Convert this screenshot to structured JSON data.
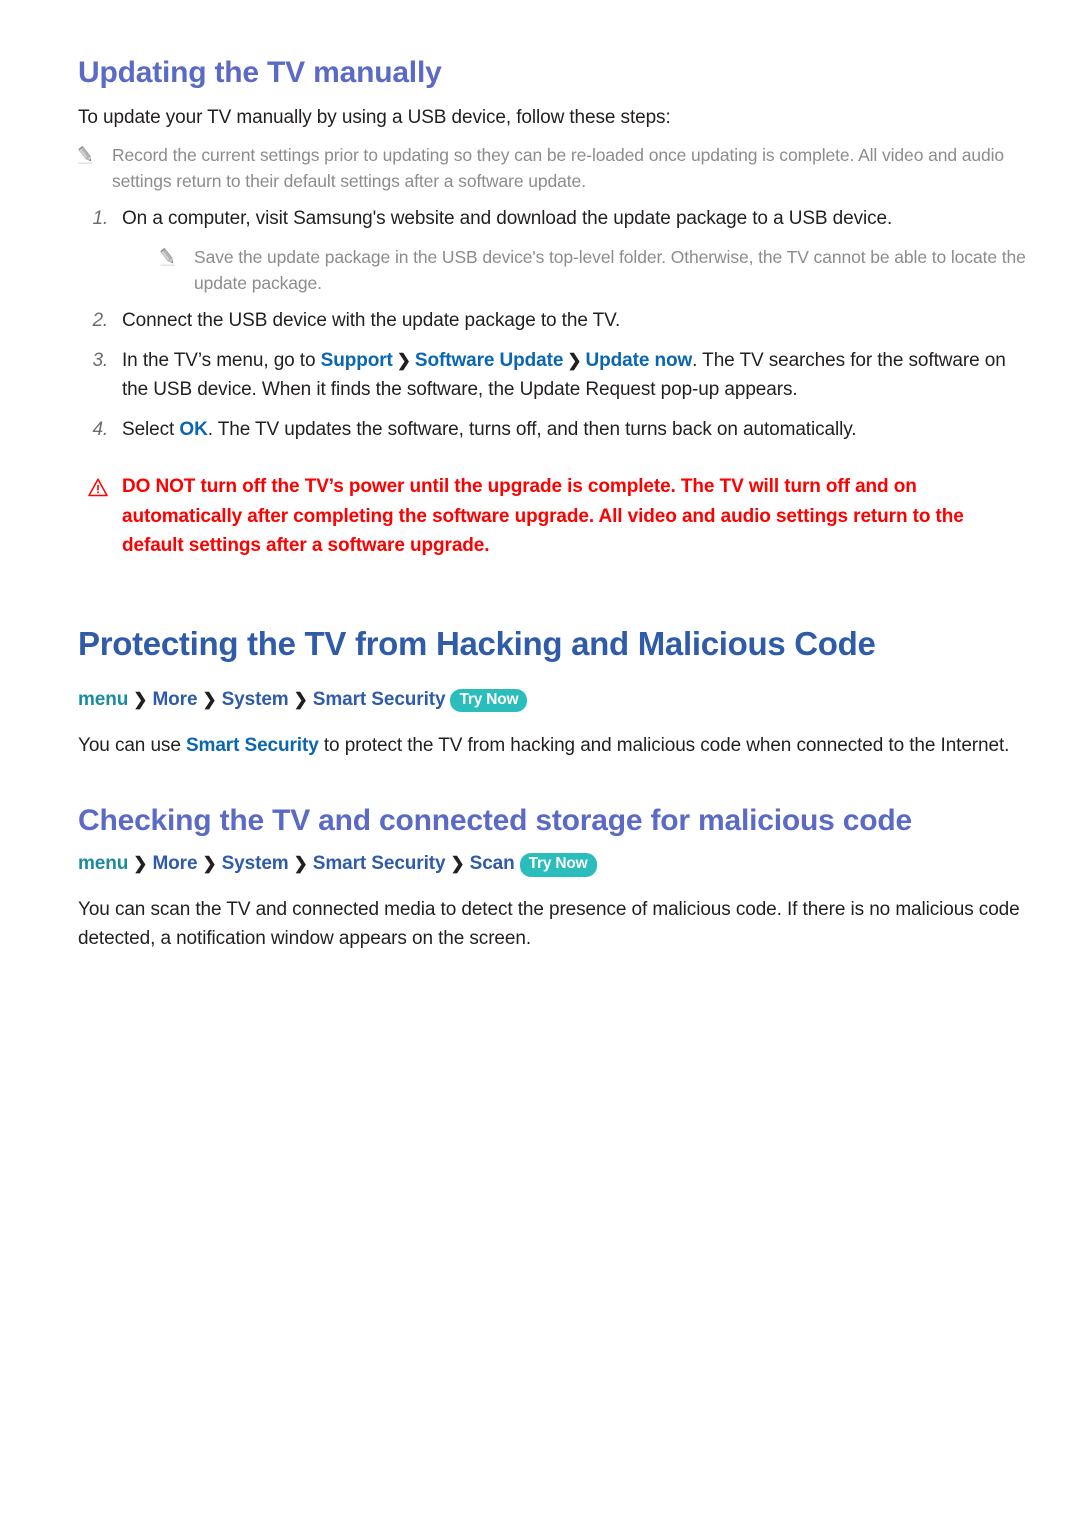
{
  "section_update": {
    "heading": "Updating the TV manually",
    "intro": "To update your TV manually by using a USB device, follow these steps:",
    "note_top": "Record the current settings prior to updating so they can be re-loaded once updating is complete. All video and audio settings return to their default settings after a software update.",
    "steps": [
      {
        "num": "1.",
        "text": "On a computer, visit Samsung's website and download the update package to a USB device.",
        "note": "Save the update package in the USB device's top-level folder. Otherwise, the TV cannot be able to locate the update package."
      },
      {
        "num": "2.",
        "text": "Connect the USB device with the update package to the TV."
      },
      {
        "num": "3.",
        "text_before": "In the TV’s menu, go to ",
        "link_1": "Support",
        "chev_1": "❯",
        "link_2": "Software Update",
        "chev_2": "❯",
        "link_3": "Update now",
        "text_after": ". The TV searches for the software on the USB device. When it finds the software, the Update Request pop-up appears."
      },
      {
        "num": "4.",
        "text_before": "Select ",
        "link_1": "OK",
        "text_after": ". The TV updates the software, turns off, and then turns back on automatically."
      }
    ],
    "warning": "DO NOT turn off the TV’s power until the upgrade is complete. The TV will turn off and on automatically after completing the software upgrade. All video and audio settings return to the default settings after a software upgrade."
  },
  "section_protecting": {
    "heading": "Protecting the TV from Hacking and Malicious Code",
    "menu_path": {
      "root": "menu",
      "items": [
        "More",
        "System",
        "Smart Security"
      ],
      "chevron": "❯",
      "badge": "Try Now"
    },
    "paragraph_before": "You can use ",
    "paragraph_link": "Smart Security",
    "paragraph_after": " to protect the TV from hacking and malicious code when connected to the Internet."
  },
  "section_checking": {
    "heading": "Checking the TV and connected storage for malicious code",
    "menu_path": {
      "root": "menu",
      "items": [
        "More",
        "System",
        "Smart Security",
        "Scan"
      ],
      "chevron": "❯",
      "badge": "Try Now"
    },
    "paragraph": "You can scan the TV and connected media to detect the presence of malicious code. If there is no malicious code detected, a notification window appears on the screen."
  },
  "colors": {
    "sub_heading": "#5b6ac4",
    "main_heading": "#2f5ba8",
    "link": "#0b66b0",
    "menu_root": "#1a8ca0",
    "badge_bg": "#2bbcbc",
    "warning": "#ff0000",
    "note_text": "#8c8c8c"
  },
  "icons": {
    "note": "pencil-icon",
    "warning": "warning-triangle-icon"
  }
}
